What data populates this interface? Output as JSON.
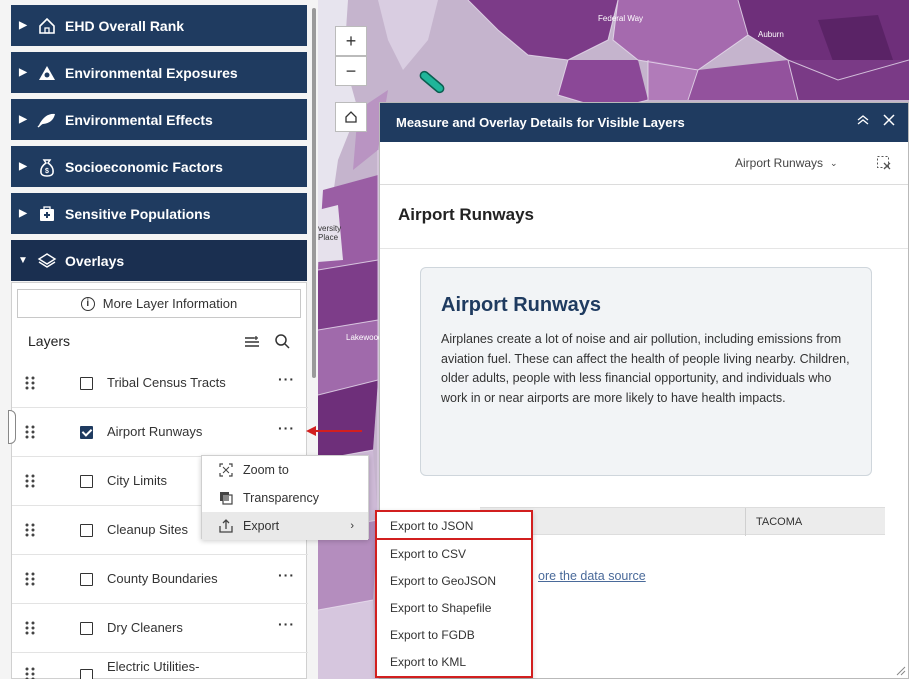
{
  "sidebar": {
    "categories": [
      {
        "label": "EHD Overall Rank",
        "icon": "home-icon",
        "expanded": false
      },
      {
        "label": "Environmental Exposures",
        "icon": "warning-icon",
        "expanded": false
      },
      {
        "label": "Environmental Effects",
        "icon": "leaf-icon",
        "expanded": false
      },
      {
        "label": "Socioeconomic Factors",
        "icon": "money-bag-icon",
        "expanded": false
      },
      {
        "label": "Sensitive Populations",
        "icon": "first-aid-icon",
        "expanded": false
      },
      {
        "label": "Overlays",
        "icon": "layers-icon",
        "expanded": true
      }
    ],
    "more_info_label": "More Layer Information",
    "layers_title": "Layers",
    "layers": [
      {
        "name": "Tribal Census Tracts",
        "checked": false
      },
      {
        "name": "Airport Runways",
        "checked": true
      },
      {
        "name": "City Limits",
        "checked": false
      },
      {
        "name": "Cleanup Sites",
        "checked": false
      },
      {
        "name": "County Boundaries",
        "checked": false
      },
      {
        "name": "Dry Cleaners",
        "checked": false
      },
      {
        "name": "Electric Utilities-",
        "checked": false
      }
    ]
  },
  "context_menu": {
    "items": [
      {
        "label": "Zoom to",
        "icon": "zoom-to-icon"
      },
      {
        "label": "Transparency",
        "icon": "transparency-icon"
      },
      {
        "label": "Export",
        "icon": "export-icon",
        "has_submenu": true
      }
    ]
  },
  "export_menu": {
    "items": [
      "Export to JSON",
      "Export to CSV",
      "Export to GeoJSON",
      "Export to Shapefile",
      "Export to FGDB",
      "Export to KML"
    ]
  },
  "map": {
    "zoom_in": "+",
    "zoom_out": "−",
    "labels": {
      "top_road": "Federal Way",
      "top_city": "Auburn",
      "left_place": "versity Place",
      "lakewood": "Lakewood"
    }
  },
  "panel": {
    "title": "Measure and Overlay Details for Visible Layers",
    "layer_select": "Airport Runways",
    "layer_title": "Airport Runways",
    "card_title": "Airport Runways",
    "card_description": "Airplanes create a lot of noise and air pollution, including emissions from aviation fuel. These can affect the health of people living nearby. Children, older adults, people with less financial opportunity, and individuals who work in or near airports are more likely to have health impacts.",
    "table_value": "TACOMA",
    "source_link": "ore the data source"
  },
  "colors": {
    "sidebar_header": "#1f3b60",
    "annotation_red": "#d21f1f",
    "map_purple_dark": "#6e2f7a",
    "map_purple_light": "#cdb9d6"
  }
}
